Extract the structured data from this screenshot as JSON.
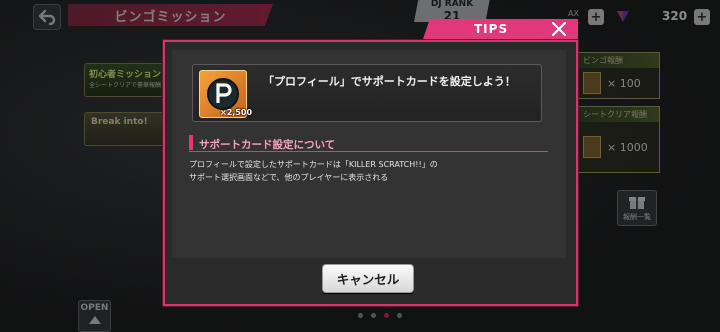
{
  "header": {
    "title": "ビンゴミッション",
    "dj_rank_label": "DJ RANK",
    "dj_rank_value": "21",
    "ax_label": "AX",
    "gem_count": "320"
  },
  "background": {
    "banner1_text": "初心者ミッション",
    "banner1_sub": "全シートクリアで豪華報酬",
    "banner2_text": "Break into!",
    "open_label": "OPEN",
    "reward1_head": "ビンゴ報酬",
    "reward1_qty": "× 100",
    "reward2_head": "シートクリア報酬",
    "reward2_qty": "× 1000",
    "reward_list_label": "報酬一覧",
    "page_count": 4,
    "active_page": 3
  },
  "modal": {
    "tab_label": "TIPS",
    "mission_text": "「プロフィール」でサポートカードを設定しよう！",
    "mission_icon_count": "×2,500",
    "section_title": "サポートカード設定について",
    "description_line1": "プロフィールで設定したサポートカードは「KILLER SCRATCH!!」の",
    "description_line2": "サポート選択画面などで、他のプレイヤーに表示される",
    "cancel_label": "キャンセル"
  },
  "colors": {
    "accent": "#e0387a",
    "modal_border": "#d4376c",
    "section_title": "#f3a5c2"
  },
  "icons": [
    "back-arrow-icon",
    "plus-icon",
    "gem-icon",
    "close-icon",
    "p-badge-icon",
    "gift-box-icon",
    "triangle-up-icon"
  ]
}
